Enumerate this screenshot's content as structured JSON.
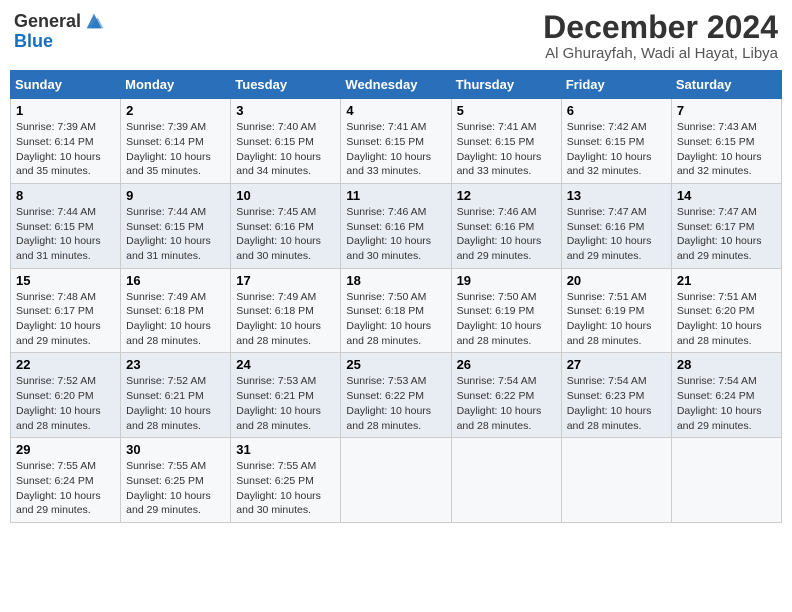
{
  "header": {
    "logo_general": "General",
    "logo_blue": "Blue",
    "title": "December 2024",
    "subtitle": "Al Ghurayfah, Wadi al Hayat, Libya"
  },
  "days_of_week": [
    "Sunday",
    "Monday",
    "Tuesday",
    "Wednesday",
    "Thursday",
    "Friday",
    "Saturday"
  ],
  "weeks": [
    [
      {
        "day": "1",
        "sunrise": "7:39 AM",
        "sunset": "6:14 PM",
        "daylight": "10 hours and 35 minutes."
      },
      {
        "day": "2",
        "sunrise": "7:39 AM",
        "sunset": "6:14 PM",
        "daylight": "10 hours and 35 minutes."
      },
      {
        "day": "3",
        "sunrise": "7:40 AM",
        "sunset": "6:15 PM",
        "daylight": "10 hours and 34 minutes."
      },
      {
        "day": "4",
        "sunrise": "7:41 AM",
        "sunset": "6:15 PM",
        "daylight": "10 hours and 33 minutes."
      },
      {
        "day": "5",
        "sunrise": "7:41 AM",
        "sunset": "6:15 PM",
        "daylight": "10 hours and 33 minutes."
      },
      {
        "day": "6",
        "sunrise": "7:42 AM",
        "sunset": "6:15 PM",
        "daylight": "10 hours and 32 minutes."
      },
      {
        "day": "7",
        "sunrise": "7:43 AM",
        "sunset": "6:15 PM",
        "daylight": "10 hours and 32 minutes."
      }
    ],
    [
      {
        "day": "8",
        "sunrise": "7:44 AM",
        "sunset": "6:15 PM",
        "daylight": "10 hours and 31 minutes."
      },
      {
        "day": "9",
        "sunrise": "7:44 AM",
        "sunset": "6:15 PM",
        "daylight": "10 hours and 31 minutes."
      },
      {
        "day": "10",
        "sunrise": "7:45 AM",
        "sunset": "6:16 PM",
        "daylight": "10 hours and 30 minutes."
      },
      {
        "day": "11",
        "sunrise": "7:46 AM",
        "sunset": "6:16 PM",
        "daylight": "10 hours and 30 minutes."
      },
      {
        "day": "12",
        "sunrise": "7:46 AM",
        "sunset": "6:16 PM",
        "daylight": "10 hours and 29 minutes."
      },
      {
        "day": "13",
        "sunrise": "7:47 AM",
        "sunset": "6:16 PM",
        "daylight": "10 hours and 29 minutes."
      },
      {
        "day": "14",
        "sunrise": "7:47 AM",
        "sunset": "6:17 PM",
        "daylight": "10 hours and 29 minutes."
      }
    ],
    [
      {
        "day": "15",
        "sunrise": "7:48 AM",
        "sunset": "6:17 PM",
        "daylight": "10 hours and 29 minutes."
      },
      {
        "day": "16",
        "sunrise": "7:49 AM",
        "sunset": "6:18 PM",
        "daylight": "10 hours and 28 minutes."
      },
      {
        "day": "17",
        "sunrise": "7:49 AM",
        "sunset": "6:18 PM",
        "daylight": "10 hours and 28 minutes."
      },
      {
        "day": "18",
        "sunrise": "7:50 AM",
        "sunset": "6:18 PM",
        "daylight": "10 hours and 28 minutes."
      },
      {
        "day": "19",
        "sunrise": "7:50 AM",
        "sunset": "6:19 PM",
        "daylight": "10 hours and 28 minutes."
      },
      {
        "day": "20",
        "sunrise": "7:51 AM",
        "sunset": "6:19 PM",
        "daylight": "10 hours and 28 minutes."
      },
      {
        "day": "21",
        "sunrise": "7:51 AM",
        "sunset": "6:20 PM",
        "daylight": "10 hours and 28 minutes."
      }
    ],
    [
      {
        "day": "22",
        "sunrise": "7:52 AM",
        "sunset": "6:20 PM",
        "daylight": "10 hours and 28 minutes."
      },
      {
        "day": "23",
        "sunrise": "7:52 AM",
        "sunset": "6:21 PM",
        "daylight": "10 hours and 28 minutes."
      },
      {
        "day": "24",
        "sunrise": "7:53 AM",
        "sunset": "6:21 PM",
        "daylight": "10 hours and 28 minutes."
      },
      {
        "day": "25",
        "sunrise": "7:53 AM",
        "sunset": "6:22 PM",
        "daylight": "10 hours and 28 minutes."
      },
      {
        "day": "26",
        "sunrise": "7:54 AM",
        "sunset": "6:22 PM",
        "daylight": "10 hours and 28 minutes."
      },
      {
        "day": "27",
        "sunrise": "7:54 AM",
        "sunset": "6:23 PM",
        "daylight": "10 hours and 28 minutes."
      },
      {
        "day": "28",
        "sunrise": "7:54 AM",
        "sunset": "6:24 PM",
        "daylight": "10 hours and 29 minutes."
      }
    ],
    [
      {
        "day": "29",
        "sunrise": "7:55 AM",
        "sunset": "6:24 PM",
        "daylight": "10 hours and 29 minutes."
      },
      {
        "day": "30",
        "sunrise": "7:55 AM",
        "sunset": "6:25 PM",
        "daylight": "10 hours and 29 minutes."
      },
      {
        "day": "31",
        "sunrise": "7:55 AM",
        "sunset": "6:25 PM",
        "daylight": "10 hours and 30 minutes."
      },
      null,
      null,
      null,
      null
    ]
  ],
  "labels": {
    "sunrise": "Sunrise:",
    "sunset": "Sunset:",
    "daylight": "Daylight:"
  }
}
